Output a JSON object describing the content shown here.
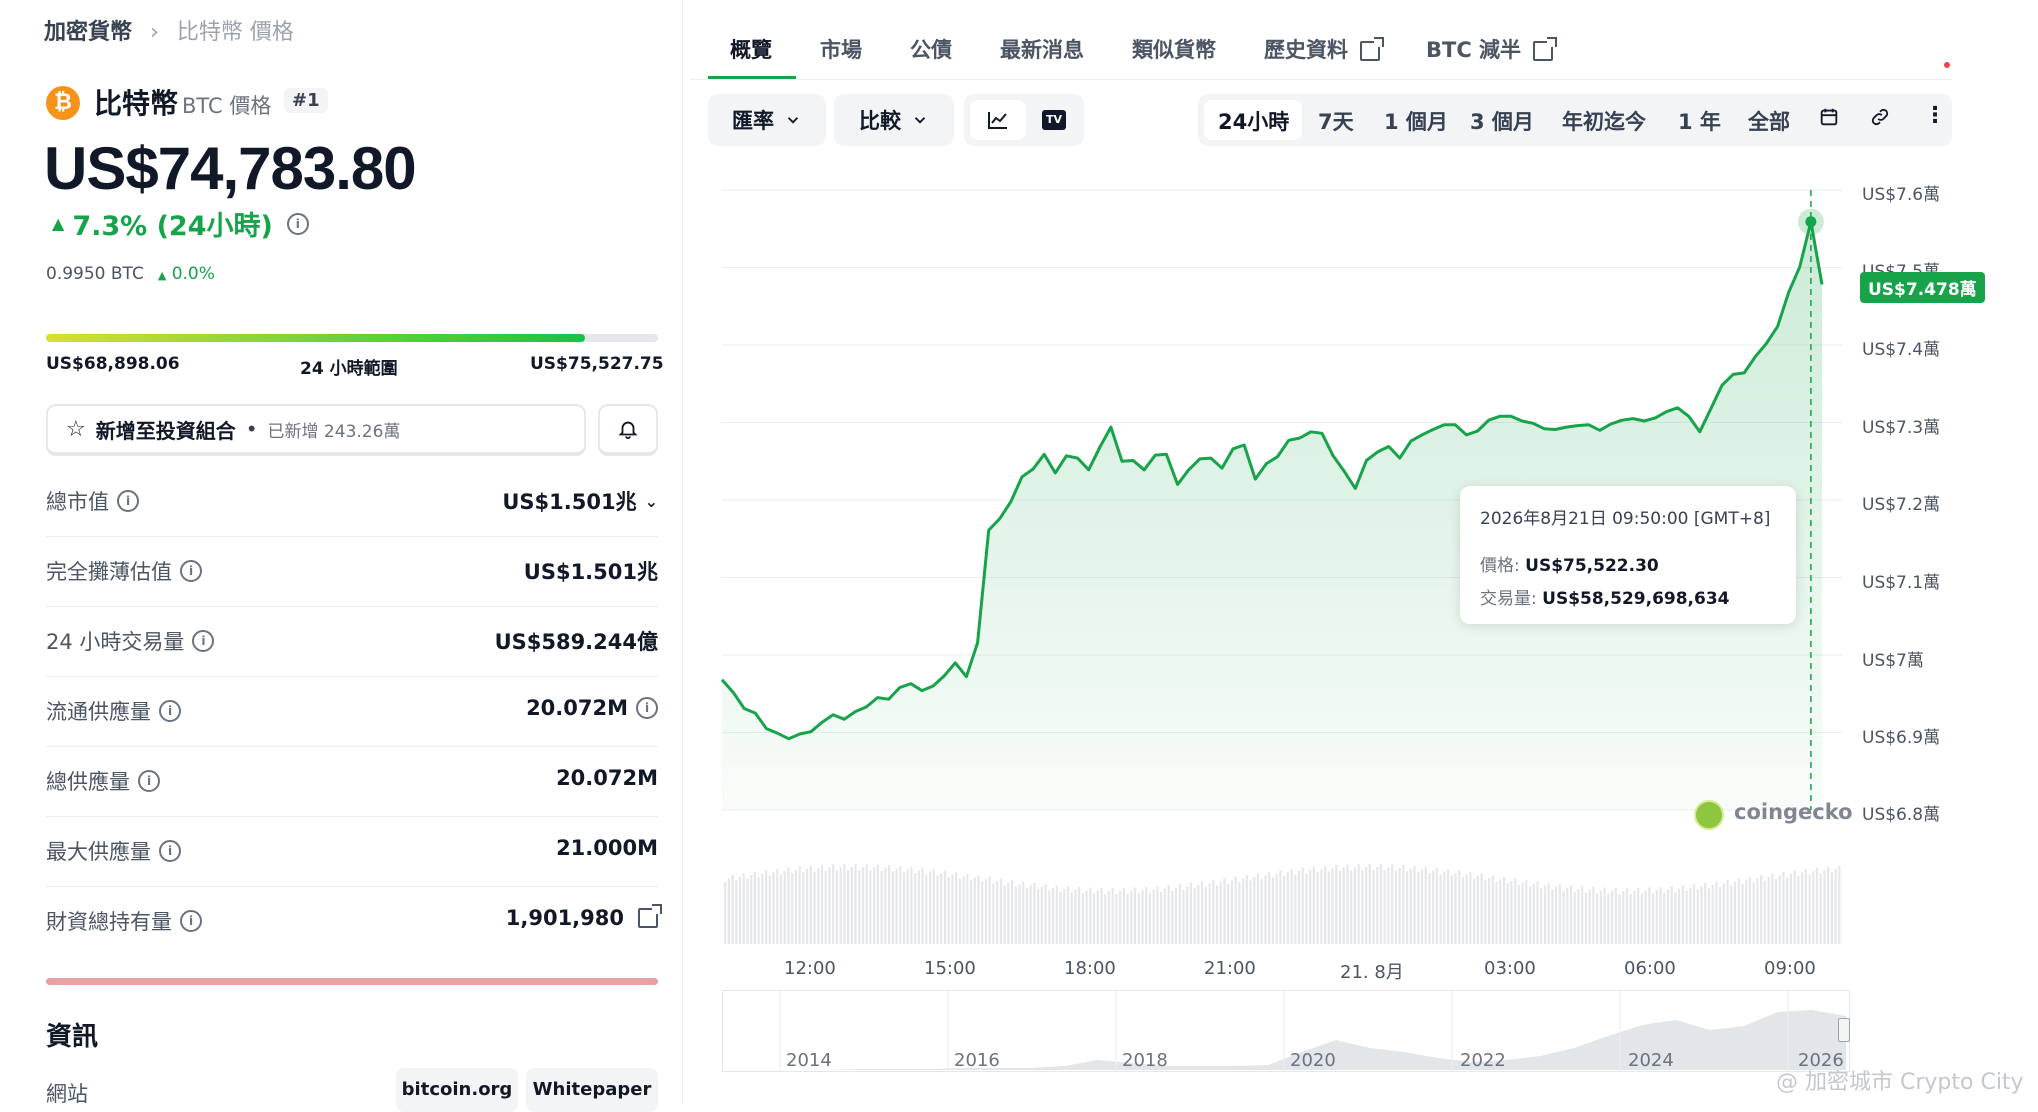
{
  "breadcrumb": {
    "root": "加密貨幣",
    "current": "比特幣 價格"
  },
  "coin": {
    "name": "比特幣",
    "subtitle": "BTC 價格",
    "rank": "#1",
    "price": "US$74,783.80",
    "change_24h": "7.3% (24小時)",
    "btc_price": "0.9950 BTC",
    "btc_change": "0.0%"
  },
  "range_24h": {
    "low": "US$68,898.06",
    "label": "24 小時範圍",
    "high": "US$75,527.75",
    "fill_fraction": 0.88
  },
  "portfolio": {
    "label": "新增至投資組合",
    "added": "已新增 243.26萬"
  },
  "stats": [
    {
      "label": "總市值",
      "value": "US$1.501兆"
    },
    {
      "label": "完全攤薄估值",
      "value": "US$1.501兆"
    },
    {
      "label": "24 小時交易量",
      "value": "US$589.244億"
    },
    {
      "label": "流通供應量",
      "value": "20.072M"
    },
    {
      "label": "總供應量",
      "value": "20.072M"
    },
    {
      "label": "最大供應量",
      "value": "21.000M"
    },
    {
      "label": "財資總持有量",
      "value": "1,901,980"
    }
  ],
  "info_section": {
    "title": "資訊",
    "website_label": "網站",
    "links": [
      "bitcoin.org",
      "Whitepaper"
    ]
  },
  "tabs": [
    "概覽",
    "市場",
    "公債",
    "最新消息",
    "類似貨幣",
    "歷史資料",
    "BTC 減半"
  ],
  "toolbar": {
    "currency_label": "匯率",
    "compare_label": "比較",
    "ranges": [
      "24小時",
      "7天",
      "1 個月",
      "3 個月",
      "年初迄今",
      "1 年",
      "全部"
    ],
    "active_range": "24小時"
  },
  "chart_data": {
    "type": "line",
    "y_tick_labels": [
      "US$7.6萬",
      "US$7.5萬",
      "US$7.4萬",
      "US$7.3萬",
      "US$7.2萬",
      "US$7.1萬",
      "US$7萬",
      "US$6.9萬",
      "US$6.8萬"
    ],
    "ylim": [
      68000,
      76000
    ],
    "x_tick_labels": [
      "12:00",
      "15:00",
      "18:00",
      "21:00",
      "21. 8月",
      "03:00",
      "06:00",
      "09:00"
    ],
    "current_price_label": "US$7.478萬",
    "tooltip": {
      "time": "2026年8月21日 09:50:00 [GMT+8]",
      "price_label": "價格:",
      "price": "US$75,522.30",
      "volume_label": "交易量:",
      "volume": "US$58,529,698,634"
    },
    "series": [
      {
        "values": [
          69680,
          69520,
          69310,
          69250,
          69050,
          68990,
          68920,
          68980,
          69010,
          69130,
          69230,
          69170,
          69270,
          69330,
          69450,
          69430,
          69580,
          69630,
          69540,
          69600,
          69730,
          69900,
          69720,
          70160,
          71610,
          71760,
          71980,
          72300,
          72400,
          72590,
          72350,
          72570,
          72540,
          72390,
          72680,
          72940,
          72500,
          72510,
          72390,
          72580,
          72590,
          72200,
          72390,
          72530,
          72540,
          72410,
          72660,
          72710,
          72270,
          72470,
          72560,
          72770,
          72800,
          72880,
          72860,
          72570,
          72370,
          72150,
          72510,
          72620,
          72690,
          72540,
          72760,
          72840,
          72910,
          72970,
          72970,
          72840,
          72890,
          73030,
          73080,
          73080,
          73020,
          72990,
          72920,
          72910,
          72940,
          72960,
          72970,
          72900,
          72980,
          73030,
          73050,
          73020,
          73060,
          73140,
          73190,
          73080,
          72880,
          73180,
          73480,
          73620,
          73640,
          73850,
          74020,
          74240,
          74680,
          75010,
          75590,
          74780
        ]
      }
    ],
    "navigator_labels": [
      "2014",
      "2016",
      "2018",
      "2020",
      "2022",
      "2024",
      "2026"
    ],
    "watermark": "coingecko"
  },
  "page_watermark": "@ 加密城市 Crypto City"
}
